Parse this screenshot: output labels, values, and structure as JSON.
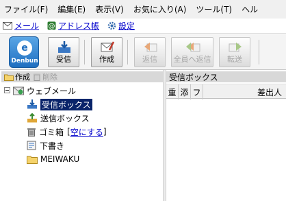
{
  "menu": [
    "ファイル(F)",
    "編集(E)",
    "表示(V)",
    "お気に入り(A)",
    "ツール(T)",
    "ヘル"
  ],
  "links": {
    "mail": "メール",
    "address_book": "アドレス帳",
    "settings": "設定"
  },
  "toolbar": {
    "logo_text": "Denbun",
    "logo_letter": "e",
    "receive": "受信",
    "compose": "作成",
    "reply": "返信",
    "reply_all": "全員へ返信",
    "forward": "転送"
  },
  "folder_actions": {
    "create": "作成",
    "delete": "削除"
  },
  "tree": {
    "root": "ウェブメール",
    "inbox": "受信ボックス",
    "sent": "送信ボックス",
    "trash": "ゴミ箱",
    "trash_bracket_open": "[",
    "empty_trash": "空にする",
    "trash_bracket_close": "]",
    "drafts": "下書き",
    "meiwaku": "MEIWAKU"
  },
  "list": {
    "title": "受信ボックス",
    "columns": [
      "重",
      "添",
      "フ",
      "差出人"
    ]
  },
  "colors": {
    "selection": "#0a246a",
    "link": "#0000cc",
    "header_bg": "#d8d8d8"
  }
}
